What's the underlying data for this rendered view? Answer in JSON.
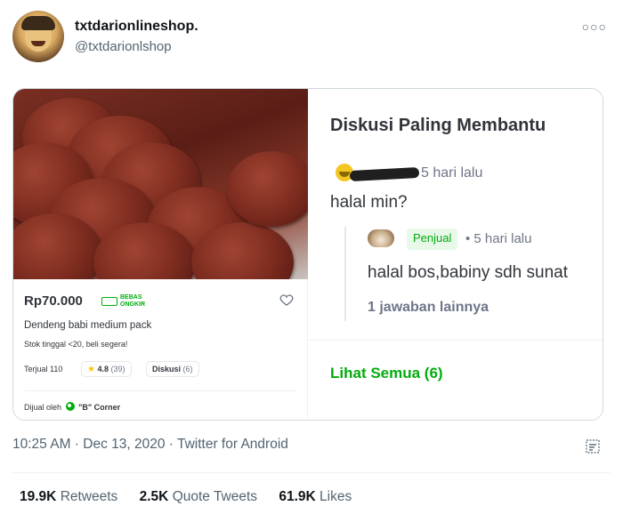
{
  "tweet": {
    "display_name": "txtdarionlineshop.",
    "handle": "@txtdarionlshop",
    "more_icon": "ellipsis-icon",
    "timestamp": "10:25 AM · Dec 13, 2020 · Twitter for Android",
    "stats": {
      "retweets_count": "19.9K",
      "retweets_label": "Retweets",
      "quotes_count": "2.5K",
      "quotes_label": "Quote Tweets",
      "likes_count": "61.9K",
      "likes_label": "Likes"
    }
  },
  "product": {
    "price": "Rp70.000",
    "free_shipping_line1": "BEBAS",
    "free_shipping_line2": "ONGKIR",
    "name": "Dendeng babi medium pack",
    "stock": "Stok tinggal <20, beli segera!",
    "sold": "Terjual 110",
    "rating": "4.8",
    "rating_count": "(39)",
    "diskusi_label": "Diskusi",
    "diskusi_count": "(6)",
    "seller_prefix": "Dijual oleh",
    "seller_name": "\"B\" Corner"
  },
  "discussion": {
    "title": "Diskusi Paling Membantu",
    "question_time": "5 hari lalu",
    "question": "halal min?",
    "reply_badge": "Penjual",
    "reply_time": "• 5 hari lalu",
    "answer": "halal bos,babiny sdh sunat",
    "more_replies": "1 jawaban lainnya",
    "see_all": "Lihat Semua (6)"
  },
  "colors": {
    "green": "#03ac0e",
    "twitter_gray": "#536471",
    "text_dark": "#0f1419"
  }
}
